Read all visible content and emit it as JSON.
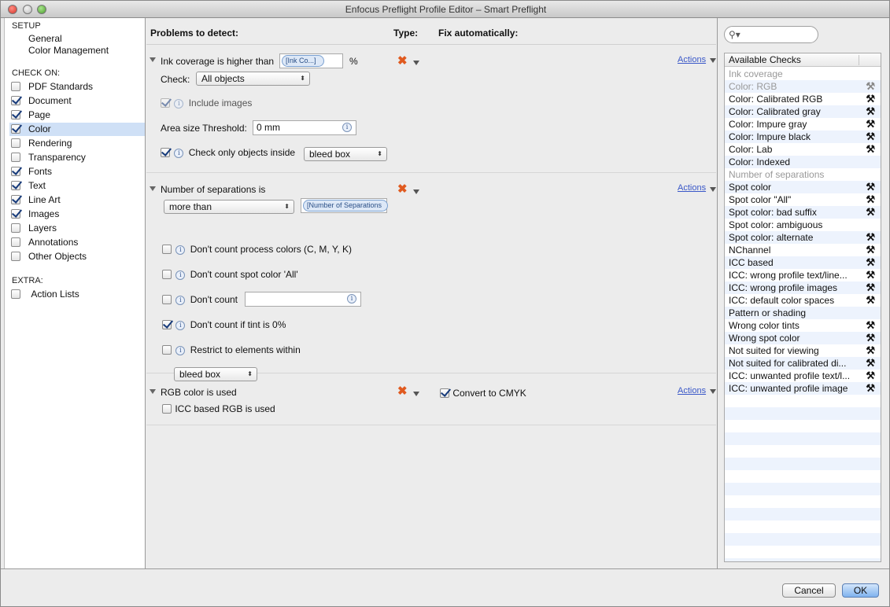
{
  "window": {
    "title": "Enfocus Preflight Profile Editor – Smart Preflight"
  },
  "sidebar": {
    "setup_heading": "SETUP",
    "setup_items": [
      "General",
      "Color Management"
    ],
    "check_heading": "CHECK ON:",
    "check_items": [
      {
        "label": "PDF Standards",
        "checked": false
      },
      {
        "label": "Document",
        "checked": true
      },
      {
        "label": "Page",
        "checked": true
      },
      {
        "label": "Color",
        "checked": true,
        "selected": true
      },
      {
        "label": "Rendering",
        "checked": false
      },
      {
        "label": "Transparency",
        "checked": false
      },
      {
        "label": "Fonts",
        "checked": true
      },
      {
        "label": "Text",
        "checked": true
      },
      {
        "label": "Line Art",
        "checked": true
      },
      {
        "label": "Images",
        "checked": true
      },
      {
        "label": "Layers",
        "checked": false
      },
      {
        "label": "Annotations",
        "checked": false
      },
      {
        "label": "Other Objects",
        "checked": false
      }
    ],
    "extra_heading": "EXTRA:",
    "extra_items": [
      {
        "label": "Action Lists",
        "checked": false
      }
    ]
  },
  "main": {
    "col_problems": "Problems to detect:",
    "col_type": "Type:",
    "col_fix": "Fix automatically:",
    "actions_label": "Actions",
    "ink": {
      "title": "Ink coverage is higher than",
      "token": "[Ink Co...]",
      "unit": "%",
      "check_label": "Check:",
      "check_value": "All objects",
      "include_images": "Include images",
      "area_label": "Area size Threshold:",
      "area_value": "0 mm",
      "only_inside": "Check only objects inside",
      "box_value": "bleed box"
    },
    "sep": {
      "title": "Number of separations is",
      "compare_value": "more than",
      "token": "[Number of Separations",
      "opt1": "Don't count process colors (C, M, Y, K)",
      "opt2": "Don't count spot color 'All'",
      "opt3": "Don't count",
      "opt3_value": "",
      "opt4": "Don't count if tint is 0%",
      "opt5": "Restrict to elements within",
      "box_value": "bleed box"
    },
    "rgb": {
      "title": "RGB color is used",
      "icc": "ICC based RGB is used",
      "convert": "Convert to CMYK"
    }
  },
  "checks": {
    "search_placeholder": "",
    "header": "Available Checks",
    "items": [
      {
        "label": "Ink coverage",
        "gray": true,
        "tool": false
      },
      {
        "label": "Color: RGB",
        "gray": true,
        "tool": true
      },
      {
        "label": "Color: Calibrated RGB",
        "gray": false,
        "tool": true
      },
      {
        "label": "Color: Calibrated gray",
        "gray": false,
        "tool": true
      },
      {
        "label": "Color: Impure gray",
        "gray": false,
        "tool": true
      },
      {
        "label": "Color: Impure black",
        "gray": false,
        "tool": true
      },
      {
        "label": "Color: Lab",
        "gray": false,
        "tool": true
      },
      {
        "label": "Color: Indexed",
        "gray": false,
        "tool": false
      },
      {
        "label": "Number of separations",
        "gray": true,
        "tool": false
      },
      {
        "label": "Spot color",
        "gray": false,
        "tool": true
      },
      {
        "label": "Spot color \"All\"",
        "gray": false,
        "tool": true
      },
      {
        "label": "Spot color: bad suffix",
        "gray": false,
        "tool": true
      },
      {
        "label": "Spot color: ambiguous",
        "gray": false,
        "tool": false
      },
      {
        "label": "Spot color: alternate",
        "gray": false,
        "tool": true
      },
      {
        "label": "NChannel",
        "gray": false,
        "tool": true
      },
      {
        "label": "ICC based",
        "gray": false,
        "tool": true
      },
      {
        "label": "ICC: wrong profile text/line...",
        "gray": false,
        "tool": true
      },
      {
        "label": "ICC: wrong profile images",
        "gray": false,
        "tool": true
      },
      {
        "label": "ICC: default color spaces",
        "gray": false,
        "tool": true
      },
      {
        "label": "Pattern or shading",
        "gray": false,
        "tool": false
      },
      {
        "label": "Wrong color tints",
        "gray": false,
        "tool": true
      },
      {
        "label": "Wrong spot color",
        "gray": false,
        "tool": true
      },
      {
        "label": "Not suited for viewing",
        "gray": false,
        "tool": true
      },
      {
        "label": "Not suited for calibrated di...",
        "gray": false,
        "tool": true
      },
      {
        "label": "ICC: unwanted profile text/l...",
        "gray": false,
        "tool": true
      },
      {
        "label": "ICC: unwanted profile image",
        "gray": false,
        "tool": true
      }
    ]
  },
  "footer": {
    "cancel": "Cancel",
    "ok": "OK"
  }
}
